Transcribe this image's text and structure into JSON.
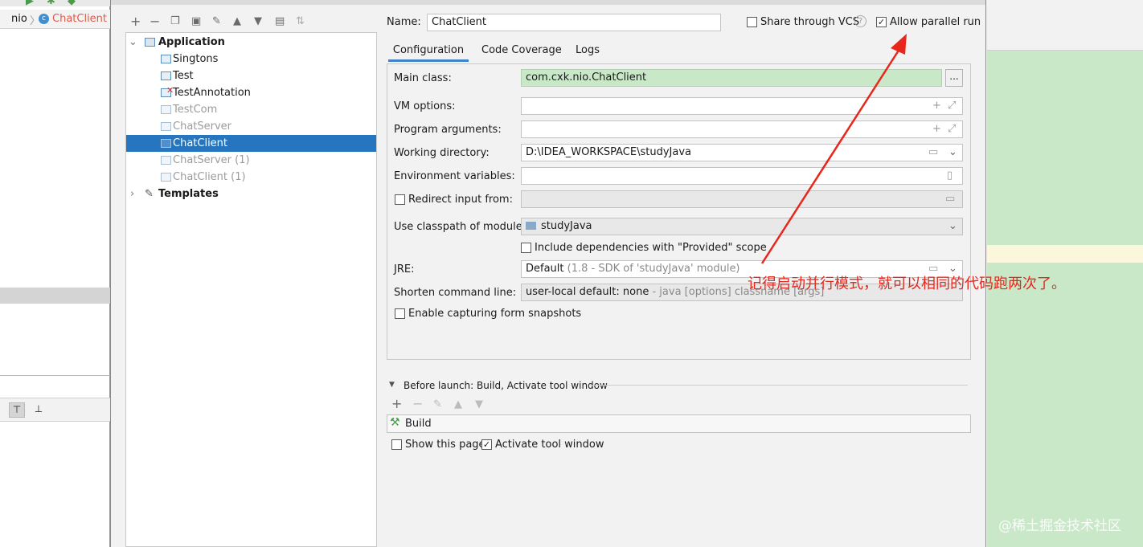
{
  "breadcrumb": {
    "item1": "nio",
    "item2": "ChatClient"
  },
  "tree": {
    "root": "Application",
    "items": [
      {
        "label": "Singtons",
        "state": "normal"
      },
      {
        "label": "Test",
        "state": "normal"
      },
      {
        "label": "TestAnnotation",
        "state": "error"
      },
      {
        "label": "TestCom",
        "state": "disabled"
      },
      {
        "label": "ChatServer",
        "state": "disabled"
      },
      {
        "label": "ChatClient",
        "state": "selected"
      },
      {
        "label": "ChatServer (1)",
        "state": "disabled"
      },
      {
        "label": "ChatClient (1)",
        "state": "disabled"
      }
    ],
    "templates": "Templates"
  },
  "header": {
    "name_label": "Name:",
    "name_value": "ChatClient",
    "share_vcs": "Share through VCS",
    "parallel_run": "Allow parallel run"
  },
  "tabs": {
    "configuration": "Configuration",
    "coverage": "Code Coverage",
    "logs": "Logs"
  },
  "form": {
    "main_class_label": "Main class:",
    "main_class_value": "com.cxk.nio.ChatClient",
    "browse_label": "...",
    "vm_label": "VM options:",
    "prog_args_label": "Program arguments:",
    "workdir_label": "Working directory:",
    "workdir_value": "D:\\IDEA_WORKSPACE\\studyJava",
    "env_label": "Environment variables:",
    "redirect_label": "Redirect input from:",
    "classpath_label": "Use classpath of module:",
    "classpath_value": "studyJava",
    "include_deps": "Include dependencies with \"Provided\" scope",
    "jre_label": "JRE:",
    "jre_value": "Default",
    "jre_hint": "(1.8 - SDK of 'studyJava' module)",
    "shorten_label": "Shorten command line:",
    "shorten_value": "user-local default: none",
    "shorten_hint": "- java [options] classname [args]",
    "snapshots_label": "Enable capturing form snapshots"
  },
  "before_launch": {
    "title": "Before launch: Build, Activate tool window",
    "build_item": "Build",
    "show_page": "Show this page",
    "activate_window": "Activate tool window"
  },
  "annotation": "记得启动并行模式，就可以相同的代码跑两次了。",
  "watermark": "@稀土掘金技术社区",
  "colors": {
    "selection": "#2675bf",
    "annotation": "#e8271c",
    "editor_green": "#c8e8c8",
    "field_green": "#c8e8c8"
  }
}
